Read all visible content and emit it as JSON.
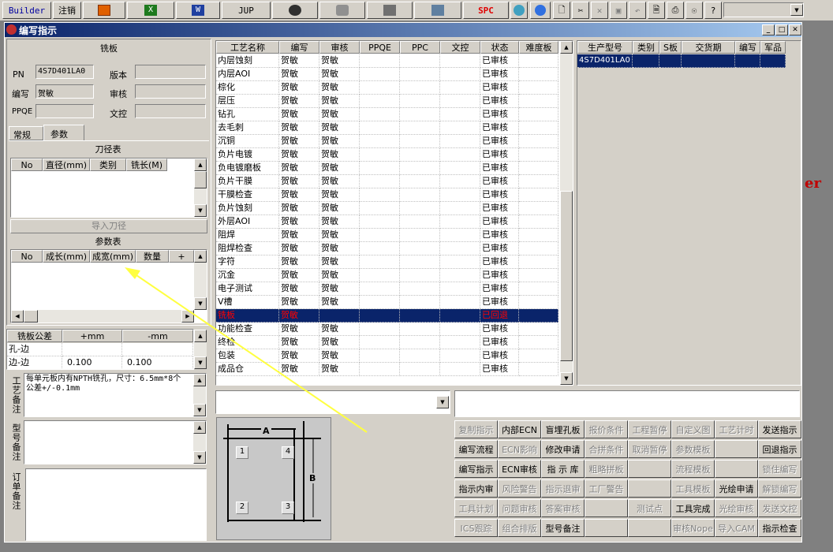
{
  "toolbar": {
    "builder": "Builder",
    "logout": "注销",
    "jup": "JUP",
    "spc": "SPC",
    "combo_value": ""
  },
  "window": {
    "title": "编写指示"
  },
  "left": {
    "section_title": "铣板",
    "pn_label": "PN",
    "pn_value": "4S7D401LA0",
    "version_label": "版本",
    "version_value": "",
    "writer_label": "编写",
    "writer_value": "贺敏",
    "review_label": "审核",
    "review_value": "",
    "ppqe_label": "PPQE",
    "ppqe_value": "",
    "doccontrol_label": "文控",
    "doccontrol_value": "",
    "tabs": [
      "常规",
      "参数"
    ],
    "tool_table_title": "刀径表",
    "tool_cols": [
      "No",
      "直径(mm)",
      "类别",
      "铣长(M)"
    ],
    "import_button": "导入刀径",
    "param_table_title": "参数表",
    "param_cols": [
      "No",
      "成长(mm)",
      "成宽(mm)",
      "数量",
      "+"
    ],
    "tol_cols": [
      "铣板公差",
      "+mm",
      "-mm"
    ],
    "tol_rows": [
      [
        "孔-边",
        "",
        ""
      ],
      [
        "边-边",
        "0.100",
        "0.100"
      ]
    ],
    "process_note_label": "工艺备注",
    "process_note": "每单元板内有NPTH铣孔，尺寸：6.5mm*8个 公差+/-0.1mm",
    "model_note_label": "型号备注",
    "order_note_label": "订单备注"
  },
  "process": {
    "cols": [
      "工艺名称",
      "编写",
      "审核",
      "PPQE",
      "PPC",
      "文控",
      "状态",
      "难度板"
    ],
    "rows": [
      [
        "内层蚀刻",
        "贺敏",
        "贺敏",
        "",
        "",
        "",
        "已审核",
        ""
      ],
      [
        "内层AOI",
        "贺敏",
        "贺敏",
        "",
        "",
        "",
        "已审核",
        ""
      ],
      [
        "棕化",
        "贺敏",
        "贺敏",
        "",
        "",
        "",
        "已审核",
        ""
      ],
      [
        "层压",
        "贺敏",
        "贺敏",
        "",
        "",
        "",
        "已审核",
        ""
      ],
      [
        "钻孔",
        "贺敏",
        "贺敏",
        "",
        "",
        "",
        "已审核",
        ""
      ],
      [
        "去毛刺",
        "贺敏",
        "贺敏",
        "",
        "",
        "",
        "已审核",
        ""
      ],
      [
        "沉铜",
        "贺敏",
        "贺敏",
        "",
        "",
        "",
        "已审核",
        ""
      ],
      [
        "负片电镀",
        "贺敏",
        "贺敏",
        "",
        "",
        "",
        "已审核",
        ""
      ],
      [
        "负电镀磨板",
        "贺敏",
        "贺敏",
        "",
        "",
        "",
        "已审核",
        ""
      ],
      [
        "负片干膜",
        "贺敏",
        "贺敏",
        "",
        "",
        "",
        "已审核",
        ""
      ],
      [
        "干膜检查",
        "贺敏",
        "贺敏",
        "",
        "",
        "",
        "已审核",
        ""
      ],
      [
        "负片蚀刻",
        "贺敏",
        "贺敏",
        "",
        "",
        "",
        "已审核",
        ""
      ],
      [
        "外层AOI",
        "贺敏",
        "贺敏",
        "",
        "",
        "",
        "已审核",
        ""
      ],
      [
        "阻焊",
        "贺敏",
        "贺敏",
        "",
        "",
        "",
        "已审核",
        ""
      ],
      [
        "阻焊检查",
        "贺敏",
        "贺敏",
        "",
        "",
        "",
        "已审核",
        ""
      ],
      [
        "字符",
        "贺敏",
        "贺敏",
        "",
        "",
        "",
        "已审核",
        ""
      ],
      [
        "沉金",
        "贺敏",
        "贺敏",
        "",
        "",
        "",
        "已审核",
        ""
      ],
      [
        "电子测试",
        "贺敏",
        "贺敏",
        "",
        "",
        "",
        "已审核",
        ""
      ],
      [
        "V槽",
        "贺敏",
        "贺敏",
        "",
        "",
        "",
        "已审核",
        ""
      ],
      [
        "铣板",
        "贺敏",
        "",
        "",
        "",
        "",
        "已回退",
        ""
      ],
      [
        "功能检查",
        "贺敏",
        "贺敏",
        "",
        "",
        "",
        "已审核",
        ""
      ],
      [
        "终检",
        "贺敏",
        "贺敏",
        "",
        "",
        "",
        "已审核",
        ""
      ],
      [
        "包装",
        "贺敏",
        "贺敏",
        "",
        "",
        "",
        "已审核",
        ""
      ],
      [
        "成品仓",
        "贺敏",
        "贺敏",
        "",
        "",
        "",
        "已审核",
        ""
      ]
    ],
    "selected_index": 19
  },
  "right": {
    "cols": [
      "生产型号",
      "类别",
      "S板",
      "交货期",
      "编写",
      "军品"
    ],
    "rows": [
      [
        "4S7D401LA0",
        "",
        "",
        "",
        "",
        ""
      ]
    ]
  },
  "diagram": {
    "label_a": "A",
    "label_b": "B",
    "n1": "1",
    "n2": "2",
    "n3": "3",
    "n4": "4"
  },
  "actions": [
    [
      "复制指示",
      "内部ECN",
      "盲埋孔板",
      "报价条件",
      "工程暂停",
      "自定义图",
      "工艺计时",
      "发送指示"
    ],
    [
      "编写流程",
      "ECN影响",
      "修改申请",
      "合拼条件",
      "取消暂停",
      "参数模板",
      "",
      "回退指示"
    ],
    [
      "编写指示",
      "ECN审核",
      "指 示 库",
      "粗略拼板",
      "",
      "流程模板",
      "",
      "锁住编写"
    ],
    [
      "指示内审",
      "风险警告",
      "指示退审",
      "工厂警告",
      "",
      "工具模板",
      "光绘申请",
      "解锁编写"
    ],
    [
      "工具计划",
      "问题审核",
      "答案审核",
      "",
      "测试点",
      "工具完成",
      "光绘审核",
      "发送文控"
    ],
    [
      "ICS跟踪",
      "组合排版",
      "型号备注",
      "",
      "",
      "审核Nope",
      "导入CAM",
      "指示检查"
    ]
  ],
  "actions_enabled": [
    [
      false,
      true,
      true,
      false,
      false,
      false,
      false,
      true
    ],
    [
      true,
      false,
      true,
      false,
      false,
      false,
      false,
      true
    ],
    [
      true,
      true,
      true,
      false,
      false,
      false,
      false,
      false
    ],
    [
      true,
      false,
      false,
      false,
      false,
      false,
      true,
      false
    ],
    [
      false,
      false,
      false,
      false,
      false,
      true,
      false,
      false
    ],
    [
      false,
      false,
      true,
      false,
      false,
      false,
      false,
      true
    ]
  ],
  "colors": {
    "titlebar": "#0a246a",
    "selection": "#0a246a",
    "rejected_text": "#ff0000",
    "annotation_arrow": "#ffff40"
  }
}
